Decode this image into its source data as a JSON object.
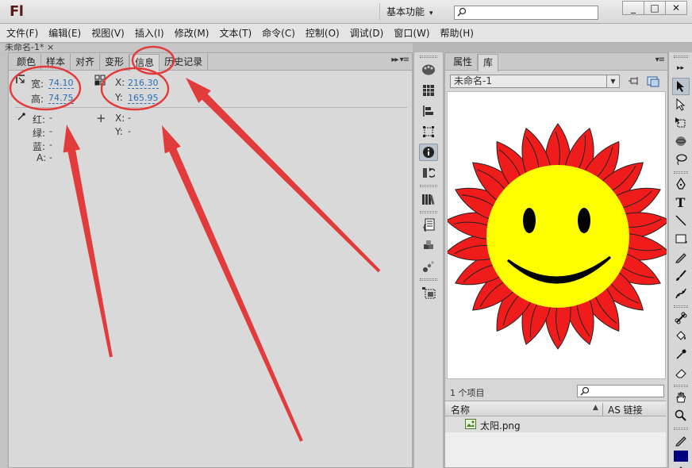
{
  "app": {
    "logo": "Fl",
    "workspace": "基本功能"
  },
  "window_controls": [
    "_",
    "□",
    "✕"
  ],
  "menu": [
    "文件(F)",
    "编辑(E)",
    "视图(V)",
    "插入(I)",
    "修改(M)",
    "文本(T)",
    "命令(C)",
    "控制(O)",
    "调试(D)",
    "窗口(W)",
    "帮助(H)"
  ],
  "doc_tab": "未命名-1* ×",
  "info_panel": {
    "tabs": [
      "颜色",
      "样本",
      "对齐",
      "变形",
      "信息",
      "历史记录"
    ],
    "active_tab": "信息",
    "width_label": "宽:",
    "width_value": "74.10",
    "height_label": "高:",
    "height_value": "74.75",
    "x_label": "X:",
    "x_value": "216.30",
    "y_label": "Y:",
    "y_value": "165.95",
    "red_label": "红:",
    "green_label": "绿:",
    "blue_label": "蓝:",
    "alpha_label": "A:",
    "cursor_x_label": "X:",
    "cursor_y_label": "Y:",
    "empty_value": "-",
    "panel_controls": "▸▸ ▾≡"
  },
  "library_panel": {
    "tabs": [
      "属性",
      "库"
    ],
    "active_tab": "库",
    "document": "未命名-1",
    "item_count": "1 个项目",
    "col_name": "名称",
    "col_linkage": "AS 链接",
    "sort_arrow": "▲",
    "items": [
      {
        "name": "太阳.png",
        "icon": "bitmap-icon"
      }
    ],
    "panel_controls": "▾≡"
  },
  "colors": {
    "annotation": "#e23b3b",
    "link_value": "#2a6fb7",
    "stroke_swatch": "#000080",
    "sun_petal": "#f01c1c",
    "sun_face": "#ffff00"
  }
}
